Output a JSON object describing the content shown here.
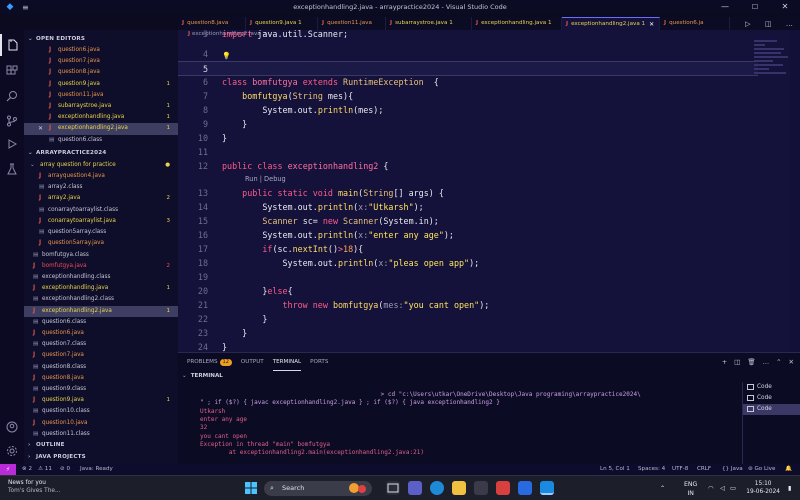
{
  "window": {
    "title": "exceptionhandling2.java - arraypractice2024 - Visual Studio Code",
    "controls": [
      "minimize",
      "maximize",
      "close"
    ]
  },
  "activity_bar": [
    "explorer",
    "search",
    "source-control",
    "run-debug",
    "extensions",
    "testing",
    "accounts",
    "settings"
  ],
  "sidebar": {
    "open_editors_title": "OPEN EDITORS",
    "open_editors": [
      {
        "label": "question6.java",
        "color": "red",
        "badge": ""
      },
      {
        "label": "question7.java",
        "color": "red",
        "badge": ""
      },
      {
        "label": "question8.java",
        "color": "red",
        "badge": ""
      },
      {
        "label": "question9.java",
        "color": "yellow",
        "badge": "1"
      },
      {
        "label": "question11.java",
        "color": "red",
        "badge": ""
      },
      {
        "label": "subarraystroe.java",
        "color": "yellow",
        "badge": "1"
      },
      {
        "label": "exceptionhandling.java",
        "color": "yellow",
        "badge": "1"
      },
      {
        "label": "exceptionhandling2.java",
        "color": "yellow",
        "badge": "1",
        "selected": true
      },
      {
        "label": "question6.class",
        "color": "gray",
        "badge": ""
      }
    ],
    "project_title": "ARRAYPRACTICE2024",
    "folder": {
      "label": "array question for practice",
      "badge": "●"
    },
    "folder_items": [
      {
        "label": "arrayquestion4.java",
        "color": "red",
        "badge": ""
      },
      {
        "label": "array2.class",
        "color": "gray",
        "badge": ""
      },
      {
        "label": "array2.java",
        "color": "yellow",
        "badge": "2"
      },
      {
        "label": "conarraytoarraylist.class",
        "color": "gray",
        "badge": ""
      },
      {
        "label": "conarraytoarraylist.java",
        "color": "yellow",
        "badge": "3"
      },
      {
        "label": "question5array.class",
        "color": "gray",
        "badge": ""
      },
      {
        "label": "question5array.java",
        "color": "red",
        "badge": ""
      }
    ],
    "root_items": [
      {
        "label": "bomfutgya.class",
        "color": "gray",
        "badge": ""
      },
      {
        "label": "bomfutgya.java",
        "color": "redbright",
        "badge": "2"
      },
      {
        "label": "exceptionhandling.class",
        "color": "gray",
        "badge": ""
      },
      {
        "label": "exceptionhandling.java",
        "color": "yellow",
        "badge": "1"
      },
      {
        "label": "exceptionhandling2.class",
        "color": "gray",
        "badge": ""
      },
      {
        "label": "exceptionhandling2.java",
        "color": "yellow",
        "badge": "1",
        "selected": true
      },
      {
        "label": "question6.class",
        "color": "gray",
        "badge": ""
      },
      {
        "label": "question6.java",
        "color": "red",
        "badge": ""
      },
      {
        "label": "question7.class",
        "color": "gray",
        "badge": ""
      },
      {
        "label": "question7.java",
        "color": "red",
        "badge": ""
      },
      {
        "label": "question8.class",
        "color": "gray",
        "badge": ""
      },
      {
        "label": "question8.java",
        "color": "red",
        "badge": ""
      },
      {
        "label": "question9.class",
        "color": "gray",
        "badge": ""
      },
      {
        "label": "question9.java",
        "color": "yellow",
        "badge": "1"
      },
      {
        "label": "question10.class",
        "color": "gray",
        "badge": ""
      },
      {
        "label": "question10.java",
        "color": "red",
        "badge": ""
      },
      {
        "label": "question11.class",
        "color": "gray",
        "badge": ""
      }
    ],
    "outline_title": "OUTLINE",
    "java_projects_title": "JAVA PROJECTS"
  },
  "tabs": [
    {
      "label": "question8.java",
      "color": "red",
      "badge": ""
    },
    {
      "label": "question9.java 1",
      "color": "yellow",
      "badge": ""
    },
    {
      "label": "question11.java",
      "color": "red",
      "badge": ""
    },
    {
      "label": "subarraystroe.java 1",
      "color": "yellow",
      "badge": ""
    },
    {
      "label": "exceptionhandling.java 1",
      "color": "yellow",
      "badge": ""
    },
    {
      "label": "exceptionhandling2.java 1",
      "color": "yellow",
      "badge": "",
      "active": true
    },
    {
      "label": "question6.ja",
      "color": "red",
      "badge": ""
    }
  ],
  "editor": {
    "breadcrumb": "exceptionhandling2.java > ...",
    "lines": [
      {
        "n": "3",
        "tokens": [
          [
            "kw",
            "import "
          ],
          [
            "var",
            "java.util.Scanner;"
          ]
        ]
      },
      {
        "n": "4",
        "tokens": []
      },
      {
        "n": "5",
        "tokens": [],
        "current": true
      },
      {
        "n": "6",
        "tokens": [
          [
            "kw",
            "class "
          ],
          [
            "cls",
            "bomfutgya "
          ],
          [
            "kw",
            "extends "
          ],
          [
            "type",
            "RuntimeException  "
          ],
          [
            "var",
            "{"
          ]
        ]
      },
      {
        "n": "7",
        "tokens": [
          [
            "var",
            "    "
          ],
          [
            "fn",
            "bomfutgya"
          ],
          [
            "var",
            "("
          ],
          [
            "type",
            "String "
          ],
          [
            "var",
            "mes){"
          ]
        ]
      },
      {
        "n": "8",
        "tokens": [
          [
            "var",
            "        System.out."
          ],
          [
            "fn",
            "println"
          ],
          [
            "var",
            "(mes);"
          ]
        ]
      },
      {
        "n": "9",
        "tokens": [
          [
            "var",
            "    }"
          ]
        ]
      },
      {
        "n": "10",
        "tokens": [
          [
            "var",
            "}"
          ]
        ]
      },
      {
        "n": "11",
        "tokens": []
      },
      {
        "n": "12",
        "tokens": [
          [
            "kw",
            "public class "
          ],
          [
            "cls",
            "exceptionhandling2 "
          ],
          [
            "var",
            "{"
          ]
        ]
      },
      {
        "n": "13",
        "tokens": [
          [
            "var",
            "    "
          ],
          [
            "kw",
            "public static void "
          ],
          [
            "fn",
            "main"
          ],
          [
            "var",
            "("
          ],
          [
            "type",
            "String"
          ],
          [
            "var",
            "[] args) {"
          ]
        ]
      },
      {
        "n": "14",
        "tokens": [
          [
            "var",
            "        System.out."
          ],
          [
            "fn",
            "println"
          ],
          [
            "var",
            "("
          ],
          [
            "hint",
            "x:"
          ],
          [
            "str",
            "\"Utkarsh\""
          ],
          [
            "var",
            ");"
          ]
        ]
      },
      {
        "n": "15",
        "tokens": [
          [
            "var",
            "        "
          ],
          [
            "type",
            "Scanner "
          ],
          [
            "var",
            "sc= "
          ],
          [
            "kw",
            "new "
          ],
          [
            "type",
            "Scanner"
          ],
          [
            "var",
            "(System.in);"
          ]
        ]
      },
      {
        "n": "16",
        "tokens": [
          [
            "var",
            "        System.out."
          ],
          [
            "fn",
            "println"
          ],
          [
            "var",
            "("
          ],
          [
            "hint",
            "x:"
          ],
          [
            "str",
            "\"enter any age\""
          ],
          [
            "var",
            ");"
          ]
        ]
      },
      {
        "n": "17",
        "tokens": [
          [
            "var",
            "        "
          ],
          [
            "kw",
            "if"
          ],
          [
            "var",
            "(sc."
          ],
          [
            "fn",
            "nextInt"
          ],
          [
            "var",
            "()"
          ],
          [
            "op",
            ">"
          ],
          [
            "num",
            "18"
          ],
          [
            "var",
            "){"
          ]
        ]
      },
      {
        "n": "18",
        "tokens": [
          [
            "var",
            "            System.out."
          ],
          [
            "fn",
            "println"
          ],
          [
            "var",
            "("
          ],
          [
            "hint",
            "x:"
          ],
          [
            "str",
            "\"pleas open app\""
          ],
          [
            "var",
            ");"
          ]
        ]
      },
      {
        "n": "19",
        "tokens": []
      },
      {
        "n": "20",
        "tokens": [
          [
            "var",
            "        }"
          ],
          [
            "kw",
            "else"
          ],
          [
            "var",
            "{"
          ]
        ]
      },
      {
        "n": "21",
        "tokens": [
          [
            "var",
            "            "
          ],
          [
            "kw",
            "throw new "
          ],
          [
            "fn",
            "bomfutgya"
          ],
          [
            "var",
            "("
          ],
          [
            "hint",
            "mes:"
          ],
          [
            "str",
            "\"you cant open\""
          ],
          [
            "var",
            ");"
          ]
        ]
      },
      {
        "n": "22",
        "tokens": [
          [
            "var",
            "        }"
          ]
        ]
      },
      {
        "n": "23",
        "tokens": [
          [
            "var",
            "    }"
          ]
        ]
      },
      {
        "n": "24",
        "tokens": [
          [
            "var",
            "}"
          ]
        ]
      }
    ],
    "codelens": "Run | Debug"
  },
  "panel": {
    "tabs": [
      {
        "label": "PROBLEMS",
        "count": "12"
      },
      {
        "label": "OUTPUT",
        "count": ""
      },
      {
        "label": "TERMINAL",
        "count": "",
        "active": true
      },
      {
        "label": "PORTS",
        "count": ""
      }
    ],
    "terminal_title": "TERMINAL",
    "terminal_lines": [
      {
        "text": "                                                  > cd \"c:\\Users\\utkar\\OneDrive\\Desktop\\Java programing\\arraypractice2024\\",
        "kind": "cmd"
      },
      {
        "text": "\" ; if ($?) { javac exceptionhandling2.java } ; if ($?) { java exceptionhandling2 }",
        "kind": "cmd"
      },
      {
        "text": "Utkarsh",
        "kind": "out"
      },
      {
        "text": "enter any age",
        "kind": "out"
      },
      {
        "text": "32",
        "kind": "out"
      },
      {
        "text": "you cant open",
        "kind": "out"
      },
      {
        "text": "Exception in thread \"main\" bomfutgya",
        "kind": "out"
      },
      {
        "text": "        at exceptionhandling2.main(exceptionhandling2.java:21)",
        "kind": "out"
      }
    ],
    "terminal_instances": [
      "Code",
      "Code",
      "Code"
    ]
  },
  "statusbar": {
    "errors": "⊗ 2",
    "warnings": "⚠ 11",
    "ports": "⊘ 0",
    "java": "Java: Ready",
    "position": "Ln 5, Col 1",
    "spaces": "Spaces: 4",
    "encoding": "UTF-8",
    "eol": "CRLF",
    "language": "{} Java",
    "golive": "Go Live"
  },
  "taskbar": {
    "news_title": "News for you",
    "news_sub": "Tom's Gives The...",
    "search_label": "Search",
    "lang1": "ENG",
    "lang2": "IN",
    "time": "15:10",
    "date": "19-06-2024"
  },
  "colors": {
    "accent": "#b92bd8",
    "editor_bg": "#14123a",
    "keyword": "#ff5c8a",
    "string": "#ffe45c"
  }
}
